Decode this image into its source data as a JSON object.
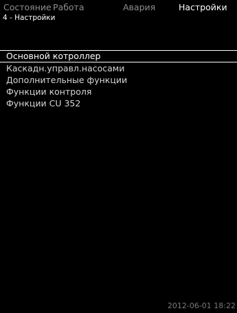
{
  "tabs": [
    {
      "label": "Состояние",
      "active": false
    },
    {
      "label": "Работа",
      "active": false
    },
    {
      "label": "Авария",
      "active": false
    },
    {
      "label": "Настройки",
      "active": true
    }
  ],
  "breadcrumb": "4 - Настройки",
  "menu": {
    "items": [
      {
        "label": "Основной котроллер",
        "selected": true
      },
      {
        "label": "Каскадн.управл.насосами",
        "selected": false
      },
      {
        "label": "Дополнительные функции",
        "selected": false
      },
      {
        "label": "Функции контроля",
        "selected": false
      },
      {
        "label": "Функции CU 352",
        "selected": false
      }
    ]
  },
  "status": {
    "timestamp": "2012-06-01 18:22"
  }
}
